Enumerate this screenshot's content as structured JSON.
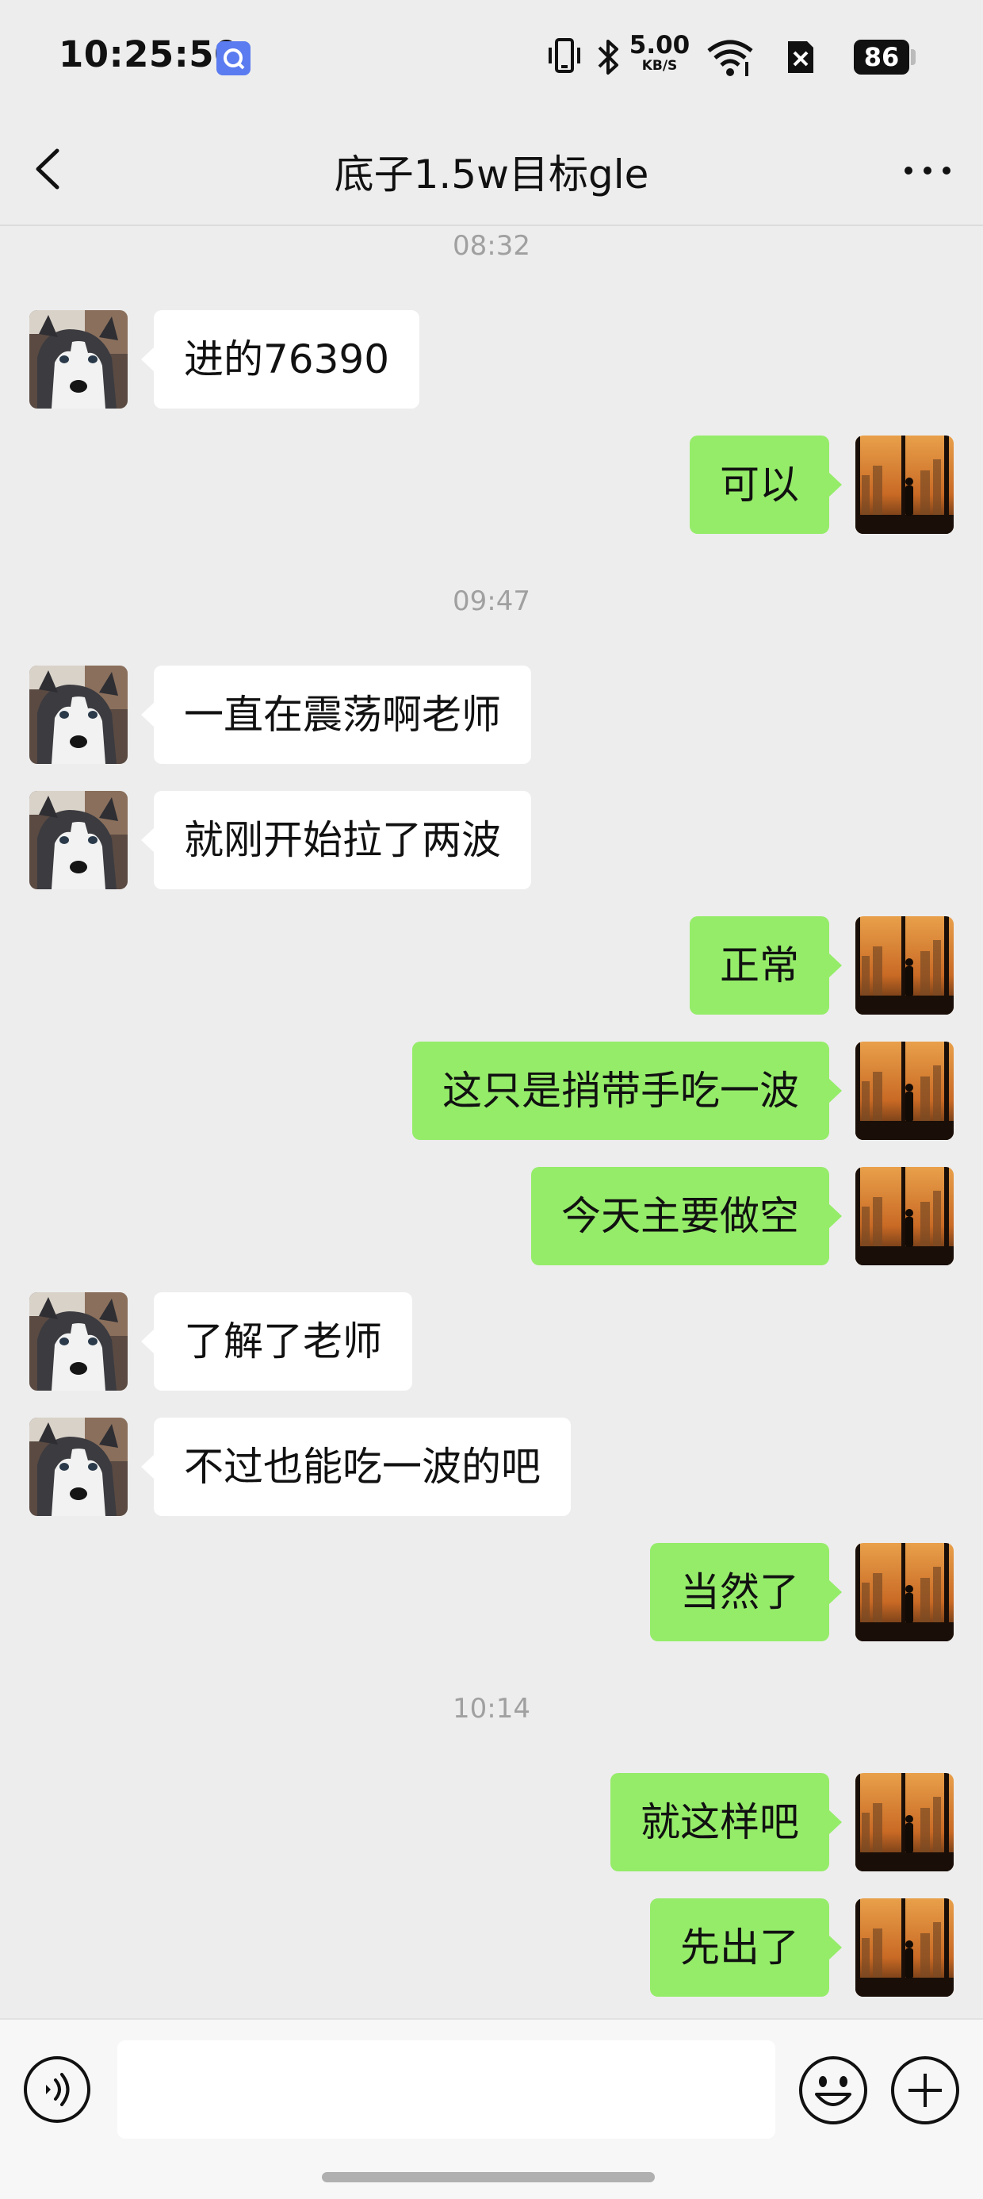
{
  "status_bar": {
    "time": "10:25:50",
    "net_speed": "5.00",
    "net_unit": "KB/S",
    "battery": "86"
  },
  "header": {
    "title": "底子1.5w目标gle"
  },
  "chat": {
    "items": [
      {
        "kind": "time",
        "text": "08:32"
      },
      {
        "kind": "msg",
        "side": "left",
        "text": "进的76390",
        "avatar": "husky"
      },
      {
        "kind": "msg",
        "side": "right",
        "text": "可以",
        "avatar": "city-silhouette"
      },
      {
        "kind": "time",
        "text": "09:47"
      },
      {
        "kind": "msg",
        "side": "left",
        "text": "一直在震荡啊老师",
        "avatar": "husky"
      },
      {
        "kind": "msg",
        "side": "left",
        "text": "就刚开始拉了两波",
        "avatar": "husky"
      },
      {
        "kind": "msg",
        "side": "right",
        "text": "正常",
        "avatar": "city-silhouette"
      },
      {
        "kind": "msg",
        "side": "right",
        "text": "这只是捎带手吃一波",
        "avatar": "city-silhouette"
      },
      {
        "kind": "msg",
        "side": "right",
        "text": "今天主要做空",
        "avatar": "city-silhouette"
      },
      {
        "kind": "msg",
        "side": "left",
        "text": "了解了老师",
        "avatar": "husky"
      },
      {
        "kind": "msg",
        "side": "left",
        "text": "不过也能吃一波的吧",
        "avatar": "husky"
      },
      {
        "kind": "msg",
        "side": "right",
        "text": "当然了",
        "avatar": "city-silhouette"
      },
      {
        "kind": "time",
        "text": "10:14"
      },
      {
        "kind": "msg",
        "side": "right",
        "text": "就这样吧",
        "avatar": "city-silhouette"
      },
      {
        "kind": "msg",
        "side": "right",
        "text": "先出了",
        "avatar": "city-silhouette"
      }
    ]
  },
  "input_bar": {
    "value": "",
    "icons": [
      "voice-icon",
      "microphone-icon",
      "emoji-icon",
      "plus-icon"
    ]
  },
  "colors": {
    "background": "#ededed",
    "sent_bubble": "#95ec69",
    "received_bubble": "#ffffff",
    "timestamp": "#a0a0a0"
  }
}
